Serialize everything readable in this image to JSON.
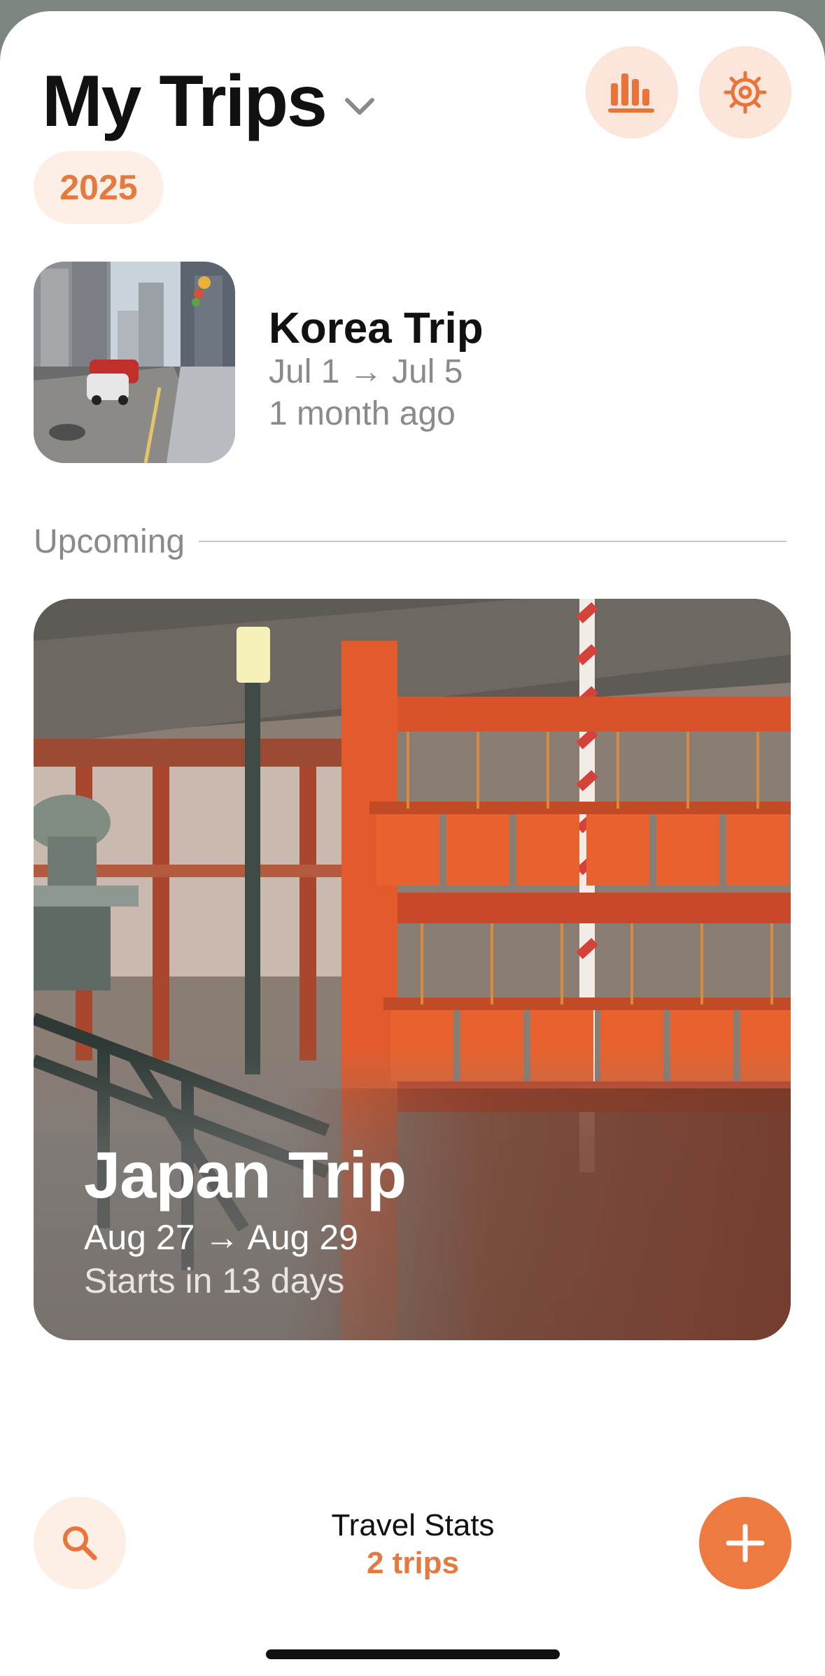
{
  "header": {
    "title": "My Trips",
    "stats_icon": "bar-chart-icon",
    "settings_icon": "gear-icon",
    "dropdown_icon": "chevron-down-icon"
  },
  "year_filter": {
    "label": "2025"
  },
  "past_trips": [
    {
      "name": "Korea Trip",
      "dates": "Jul 1 → Jul 5",
      "relative": "1 month ago",
      "image": "city-street-photo"
    }
  ],
  "upcoming": {
    "section_label": "Upcoming",
    "trip": {
      "name": "Japan Trip",
      "dates": "Aug 27 → Aug 29",
      "countdown": "Starts in 13 days",
      "image": "shrine-torii-photo"
    }
  },
  "footer": {
    "search_icon": "search-icon",
    "add_icon": "plus-icon",
    "stats_title": "Travel Stats",
    "stats_count": "2 trips"
  },
  "colors": {
    "accent": "#ec7a41",
    "accent_text": "#e47a3f",
    "accent_soft": "#fce6dc",
    "secondary_text": "#8a8a8e",
    "primary_text": "#111111"
  }
}
